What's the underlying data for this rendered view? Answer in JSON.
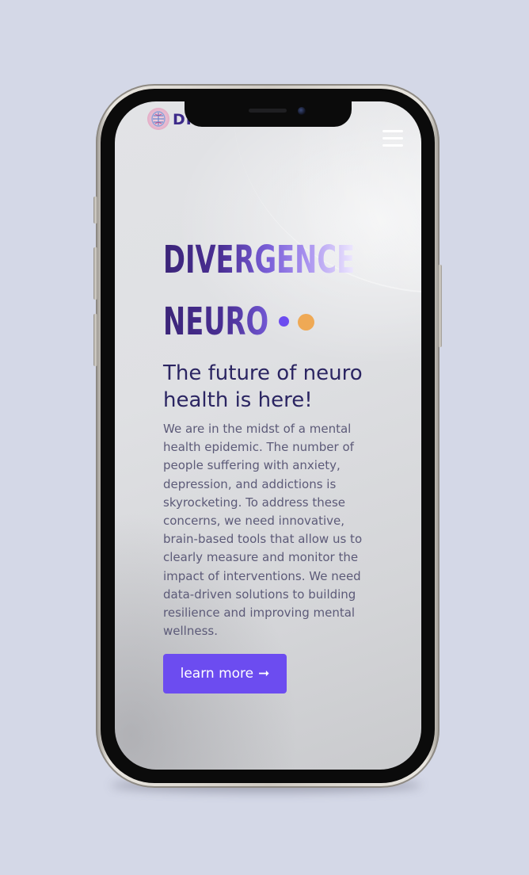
{
  "brand": {
    "logo_text": "DI",
    "colors": {
      "primary_purple": "#6c4cf0",
      "deep_purple": "#3b2478",
      "accent_orange": "#efa955",
      "page_background": "#d4d8e7"
    }
  },
  "header": {
    "menu_icon": "hamburger-menu-icon"
  },
  "hero": {
    "title_line1": "DIVERGENCE",
    "title_line2": "NEURO",
    "subtitle": "The future of neuro health is here!",
    "body": "We are in the midst of a mental health epidemic. The number of people suffering with anxiety, depression, and addictions is skyrocketing. To address these concerns, we need innovative, brain-based tools that allow us to clearly measure and monitor the impact of interventions. We need data-driven solutions to building resilience and improving mental wellness.",
    "cta_label": "learn more",
    "cta_icon": "arrow-right-icon",
    "cta_arrow": "➞"
  }
}
